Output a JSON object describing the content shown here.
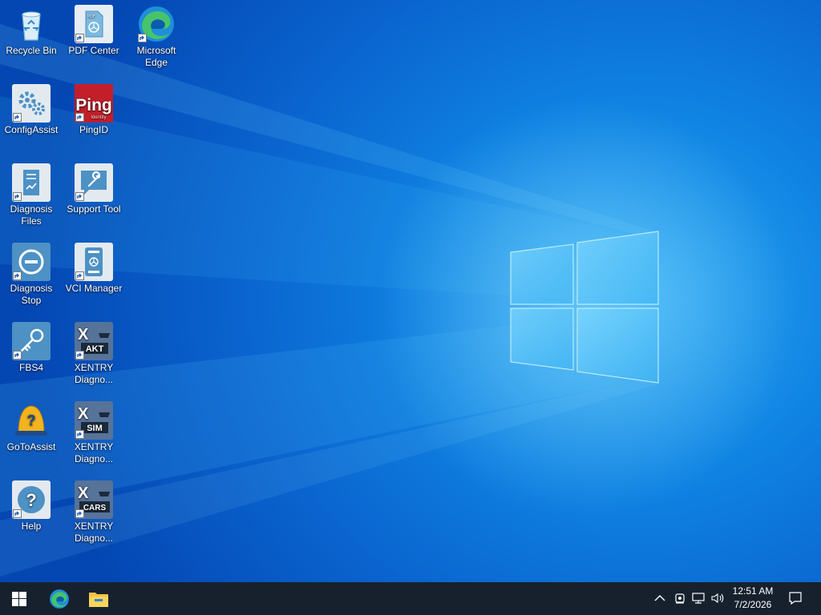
{
  "desktop": {
    "icons": [
      {
        "name": "recycle-bin-icon",
        "label": "Recycle Bin",
        "shortcut": false
      },
      {
        "name": "pdf-center-icon",
        "label": "PDF Center",
        "shortcut": true
      },
      {
        "name": "microsoft-edge-icon",
        "label": "Microsoft Edge",
        "shortcut": true
      },
      {
        "name": "configassist-icon",
        "label": "ConfigAssist",
        "shortcut": true
      },
      {
        "name": "pingid-icon",
        "label": "PingID",
        "shortcut": true,
        "logo_text": "Ping",
        "logo_subtext": "Identity"
      },
      {
        "name": "diagnosis-files-icon",
        "label": "Diagnosis Files",
        "shortcut": true
      },
      {
        "name": "support-tool-icon",
        "label": "Support Tool",
        "shortcut": true
      },
      {
        "name": "diagnosis-stop-icon",
        "label": "Diagnosis Stop",
        "shortcut": true
      },
      {
        "name": "vci-manager-icon",
        "label": "VCI Manager",
        "shortcut": true
      },
      {
        "name": "fbs4-icon",
        "label": "FBS4",
        "shortcut": true
      },
      {
        "name": "xentry-akt-icon",
        "label": "XENTRY Diagno...",
        "shortcut": true,
        "badge": "AKT"
      },
      {
        "name": "gotoassist-icon",
        "label": "GoToAssist",
        "shortcut": false
      },
      {
        "name": "xentry-sim-icon",
        "label": "XENTRY Diagno...",
        "shortcut": true,
        "badge": "SIM"
      },
      {
        "name": "help-icon",
        "label": "Help",
        "shortcut": true
      },
      {
        "name": "xentry-cars-icon",
        "label": "XENTRY Diagno...",
        "shortcut": true,
        "badge": "CARS"
      }
    ]
  },
  "taskbar": {
    "start": {
      "icon": "windows-logo-icon"
    },
    "pinned": [
      {
        "name": "edge-taskbar-icon"
      },
      {
        "name": "file-explorer-taskbar-icon"
      }
    ],
    "tray": {
      "icons": [
        "chevron-up-icon",
        "meet-now-icon",
        "network-icon",
        "volume-icon",
        "notifications-icon"
      ],
      "time": "12:51 AM",
      "date": "7/2/2026"
    }
  },
  "colors": {
    "taskbar": "#17212e",
    "accent": "#0078d7",
    "wallpaper_light": "#2ea8f2",
    "wallpaper_dark": "#0447b3"
  }
}
